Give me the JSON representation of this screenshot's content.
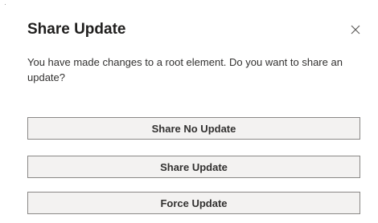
{
  "dialog": {
    "title": "Share Update",
    "message": "You have made changes to a root element. Do you want to share an update?",
    "close_icon": "close-icon"
  },
  "buttons": [
    {
      "label": "Share No Update"
    },
    {
      "label": "Share Update"
    },
    {
      "label": "Force Update"
    }
  ],
  "colors": {
    "button_background": "#f3f2f1",
    "button_border": "#8a8886",
    "title_text": "#201f1e",
    "body_text": "#323130"
  }
}
